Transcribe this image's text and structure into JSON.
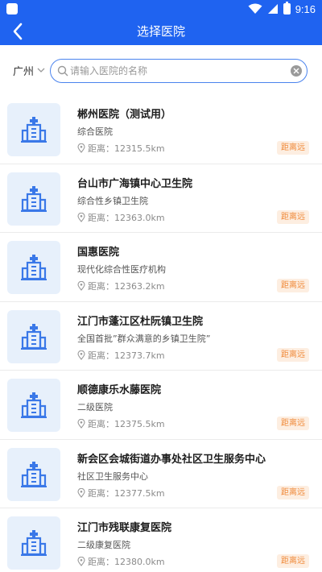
{
  "status_bar": {
    "time": "9:16"
  },
  "header": {
    "title": "选择医院"
  },
  "search": {
    "city": "广州",
    "placeholder": "请输入医院的名称"
  },
  "hospitals": [
    {
      "name": "郴州医院（测试用）",
      "type": "综合医院",
      "distance": "距离：12315.5km",
      "badge": "距离远"
    },
    {
      "name": "台山市广海镇中心卫生院",
      "type": "综合性乡镇卫生院",
      "distance": "距离：12363.0km",
      "badge": "距离远"
    },
    {
      "name": "国惠医院",
      "type": "现代化综合性医疗机构",
      "distance": "距离：12363.2km",
      "badge": "距离远"
    },
    {
      "name": "江门市蓬江区杜阮镇卫生院",
      "type": "全国首批”群众满意的乡镇卫生院”",
      "distance": "距离：12373.7km",
      "badge": "距离远"
    },
    {
      "name": "顺德康乐水藤医院",
      "type": "二级医院",
      "distance": "距离：12375.5km",
      "badge": "距离远"
    },
    {
      "name": "新会区会城街道办事处社区卫生服务中心",
      "type": "社区卫生服务中心",
      "distance": "距离：12377.5km",
      "badge": "距离远"
    },
    {
      "name": "江门市残联康复医院",
      "type": "二级康复医院",
      "distance": "距离：12380.0km",
      "badge": "距离远"
    }
  ],
  "colors": {
    "primary": "#1f63f0",
    "badge_text": "#f08a3a",
    "badge_bg": "#fdeee1",
    "thumb_bg": "#e7f0fb",
    "icon_blue": "#3a78e8"
  }
}
